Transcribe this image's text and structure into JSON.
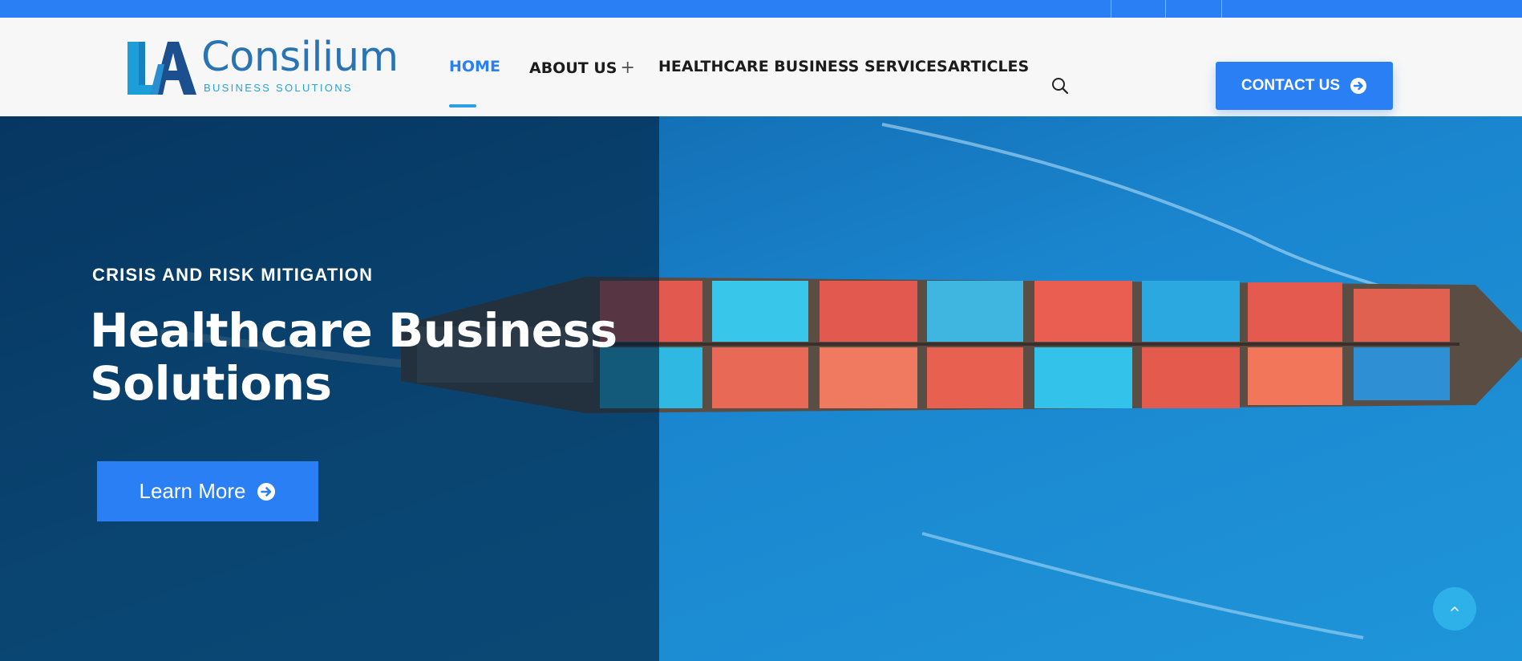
{
  "brand": {
    "name": "Consilium",
    "tagline": "BUSINESS SOLUTIONS"
  },
  "nav": {
    "items": [
      {
        "label": "HOME",
        "active": true
      },
      {
        "label": "ABOUT US",
        "has_submenu": true
      },
      {
        "label": "HEALTHCARE BUSINESS SERVICES"
      },
      {
        "label": "ARTICLES"
      }
    ],
    "submenu_indicator": "+",
    "search_icon": "search-icon"
  },
  "header": {
    "contact_label": "CONTACT US",
    "contact_icon": "arrow-circle-right-icon"
  },
  "hero": {
    "eyebrow": "CRISIS AND RISK MITIGATION",
    "title": "Healthcare Business Solutions",
    "cta_label": "Learn More",
    "cta_icon": "arrow-circle-right-icon"
  },
  "scroll_top": {
    "icon": "chevron-up-icon"
  },
  "colors": {
    "accent": "#2a7ff5",
    "logo_dark": "#2a74b4",
    "logo_light": "#27a3d8",
    "sea": "#1576c0"
  }
}
